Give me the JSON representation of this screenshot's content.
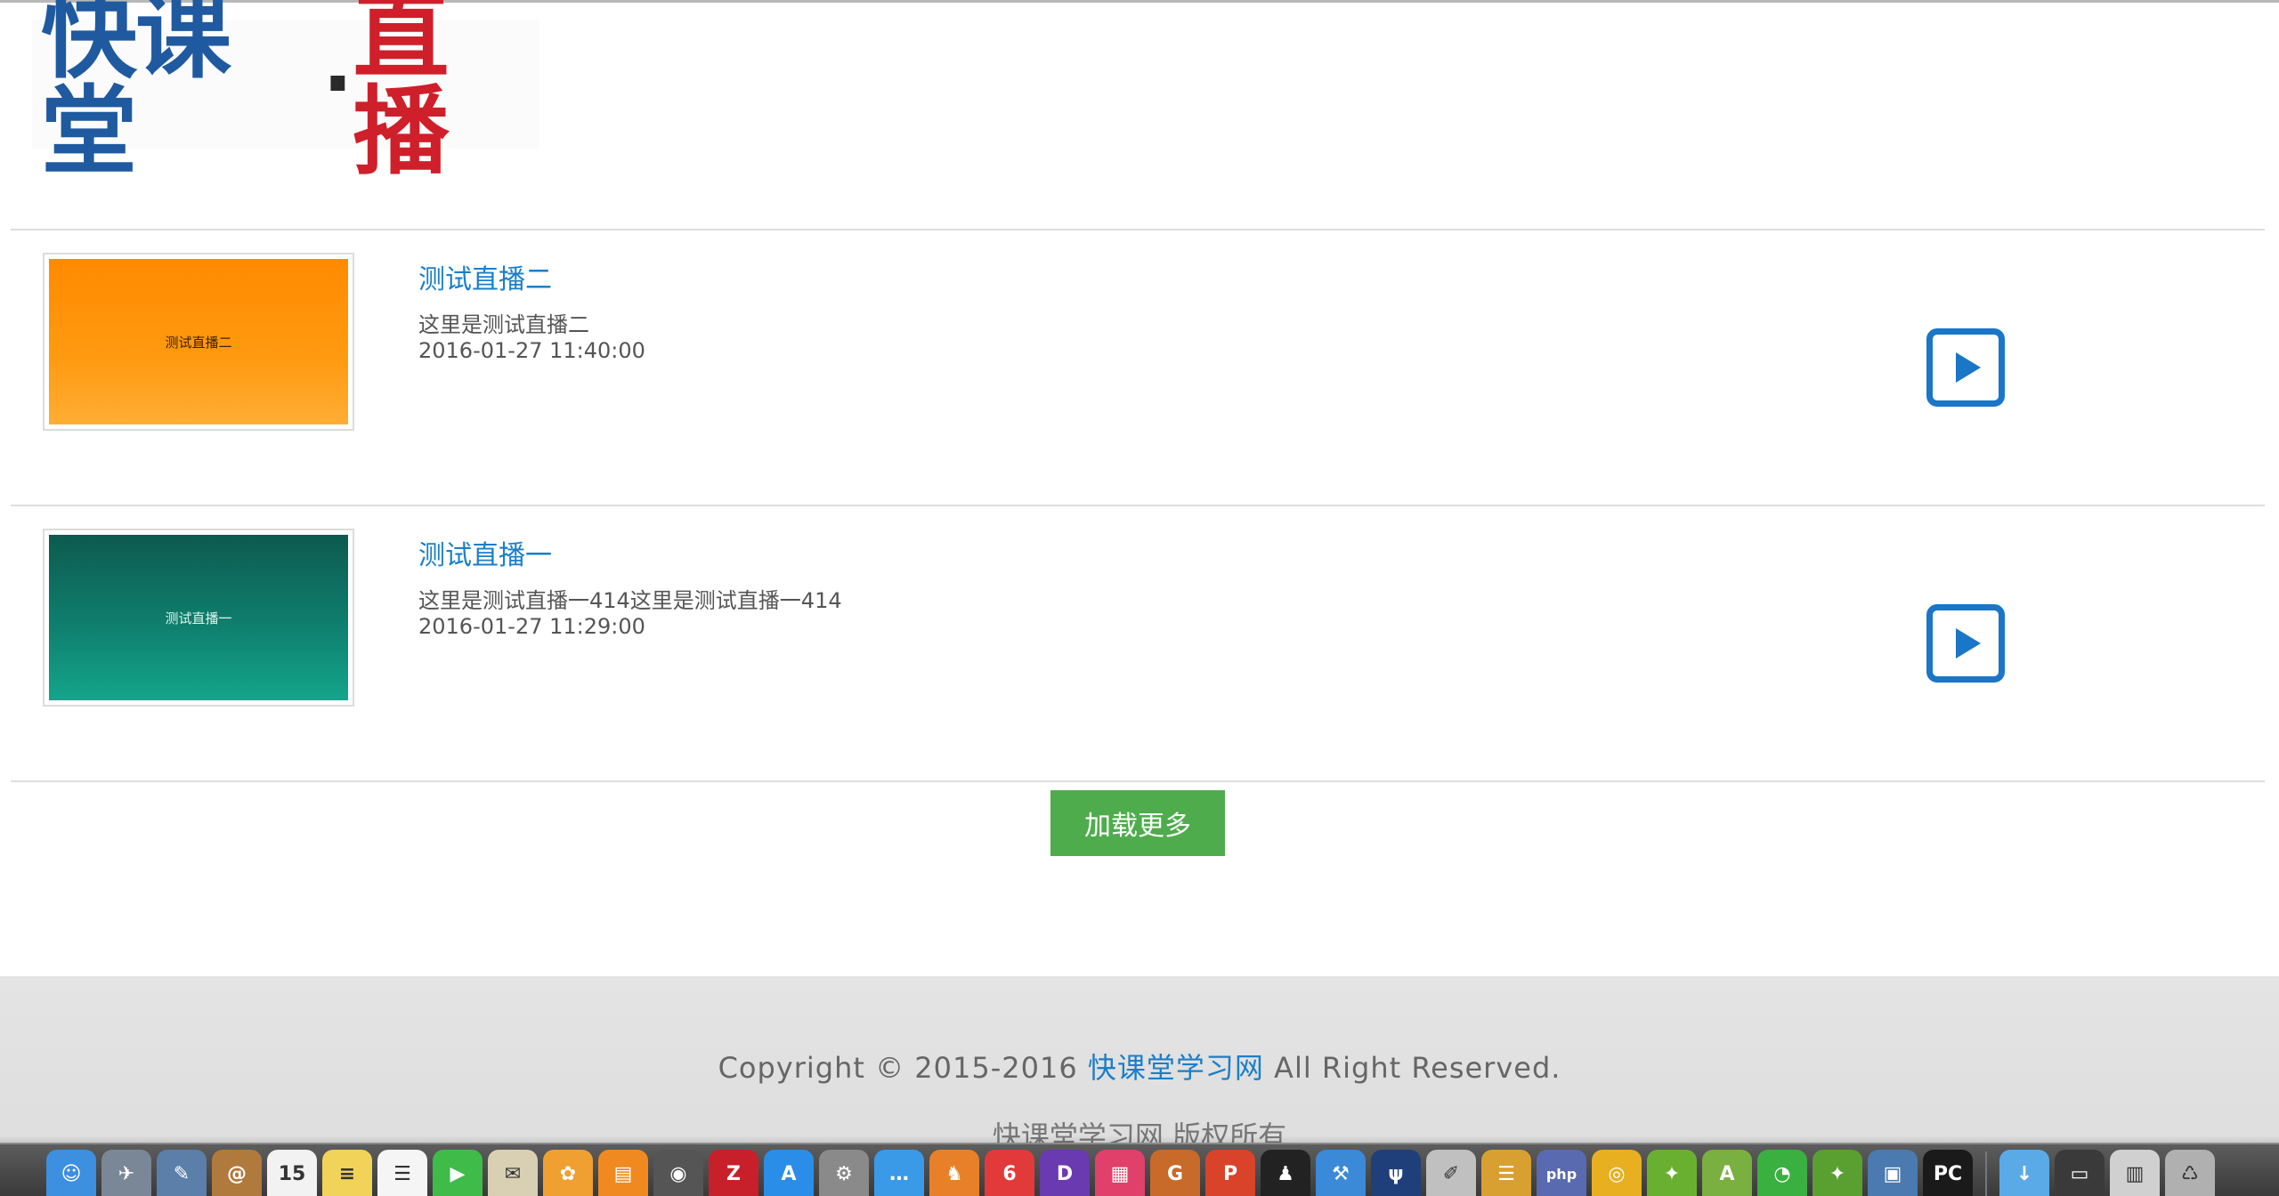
{
  "logo": {
    "part1": "快课堂",
    "dot": "·",
    "part2": "直播"
  },
  "items": [
    {
      "thumb_text": "测试直播二",
      "title": "测试直播二",
      "desc": "这里是测试直播二",
      "time": "2016-01-27 11:40:00"
    },
    {
      "thumb_text": "测试直播一",
      "title": "测试直播一",
      "desc": "这里是测试直播一414这里是测试直播一414",
      "time": "2016-01-27 11:29:00"
    }
  ],
  "load_more_label": "加载更多",
  "footer": {
    "copyright_prefix": "Copyright © 2015-2016 ",
    "copyright_link": "快课堂学习网",
    "copyright_suffix": " All Right Reserved.",
    "sub": "快课堂学习网 版权所有"
  },
  "dock": {
    "icons": [
      {
        "name": "finder-icon",
        "glyph": "☺",
        "color": "#3d8fe0"
      },
      {
        "name": "launchpad-icon",
        "glyph": "✈",
        "color": "#7a8796"
      },
      {
        "name": "preview-icon",
        "glyph": "✎",
        "color": "#5b7fa8"
      },
      {
        "name": "contacts-icon",
        "glyph": "@",
        "color": "#b07a3c"
      },
      {
        "name": "calendar-icon",
        "glyph": "15",
        "color": "#f2f2f2"
      },
      {
        "name": "notes-icon",
        "glyph": "≡",
        "color": "#f1d35a"
      },
      {
        "name": "reminders-icon",
        "glyph": "☰",
        "color": "#f5f5f5"
      },
      {
        "name": "facetime-icon",
        "glyph": "▶",
        "color": "#3fbb4a"
      },
      {
        "name": "mail-icon",
        "glyph": "✉",
        "color": "#d9d0b4"
      },
      {
        "name": "photos-icon",
        "glyph": "✿",
        "color": "#f0a030"
      },
      {
        "name": "ibooks-icon",
        "glyph": "▤",
        "color": "#f08a20"
      },
      {
        "name": "sequel-pro-icon",
        "glyph": "◉",
        "color": "#555555"
      },
      {
        "name": "filezilla-icon",
        "glyph": "Z",
        "color": "#c8202a"
      },
      {
        "name": "app-store-icon",
        "glyph": "A",
        "color": "#2a8ee8"
      },
      {
        "name": "system-preferences-icon",
        "glyph": "⚙",
        "color": "#8a8a8a"
      },
      {
        "name": "messages-icon",
        "glyph": "…",
        "color": "#3a9ae8"
      },
      {
        "name": "navicat-icon",
        "glyph": "♞",
        "color": "#e8802a"
      },
      {
        "name": "weibo-icon",
        "glyph": "6",
        "color": "#e23a3a"
      },
      {
        "name": "dash-icon",
        "glyph": "D",
        "color": "#6a3ab0"
      },
      {
        "name": "colors-icon",
        "glyph": "▦",
        "color": "#e0406a"
      },
      {
        "name": "screenflow-icon",
        "glyph": "G",
        "color": "#c86a2a"
      },
      {
        "name": "powerpoint-icon",
        "glyph": "P",
        "color": "#d8432a"
      },
      {
        "name": "qq-icon",
        "glyph": "♟",
        "color": "#222222"
      },
      {
        "name": "xcode-icon",
        "glyph": "⚒",
        "color": "#3a8ad8"
      },
      {
        "name": "sourcetree-icon",
        "glyph": "ψ",
        "color": "#1f3f7a"
      },
      {
        "name": "script-editor-icon",
        "glyph": "✐",
        "color": "#c0c0c0"
      },
      {
        "name": "sequel-icon",
        "glyph": "☰",
        "color": "#d8a030"
      },
      {
        "name": "php-icon",
        "glyph": "php",
        "color": "#5a6ab0"
      },
      {
        "name": "chrome-icon",
        "glyph": "◎",
        "color": "#e8b020"
      },
      {
        "name": "android-studio-icon",
        "glyph": "✦",
        "color": "#6ab030"
      },
      {
        "name": "android-icon",
        "glyph": "A",
        "color": "#7ab040"
      },
      {
        "name": "wechat-icon",
        "glyph": "◔",
        "color": "#3ab040"
      },
      {
        "name": "intellij-icon",
        "glyph": "✦",
        "color": "#5aa030"
      },
      {
        "name": "image-viewer-icon",
        "glyph": "▣",
        "color": "#4a7ab0"
      },
      {
        "name": "pycharm-icon",
        "glyph": "PC",
        "color": "#1a1a1a"
      },
      {
        "name": "downloads-folder-icon",
        "glyph": "↓",
        "color": "#5aaae8"
      },
      {
        "name": "screenshot-icon",
        "glyph": "▭",
        "color": "#3a3a3a"
      },
      {
        "name": "document-icon",
        "glyph": "▥",
        "color": "#d0d0d0"
      },
      {
        "name": "trash-icon",
        "glyph": "♺",
        "color": "#b0b0b0"
      }
    ]
  }
}
